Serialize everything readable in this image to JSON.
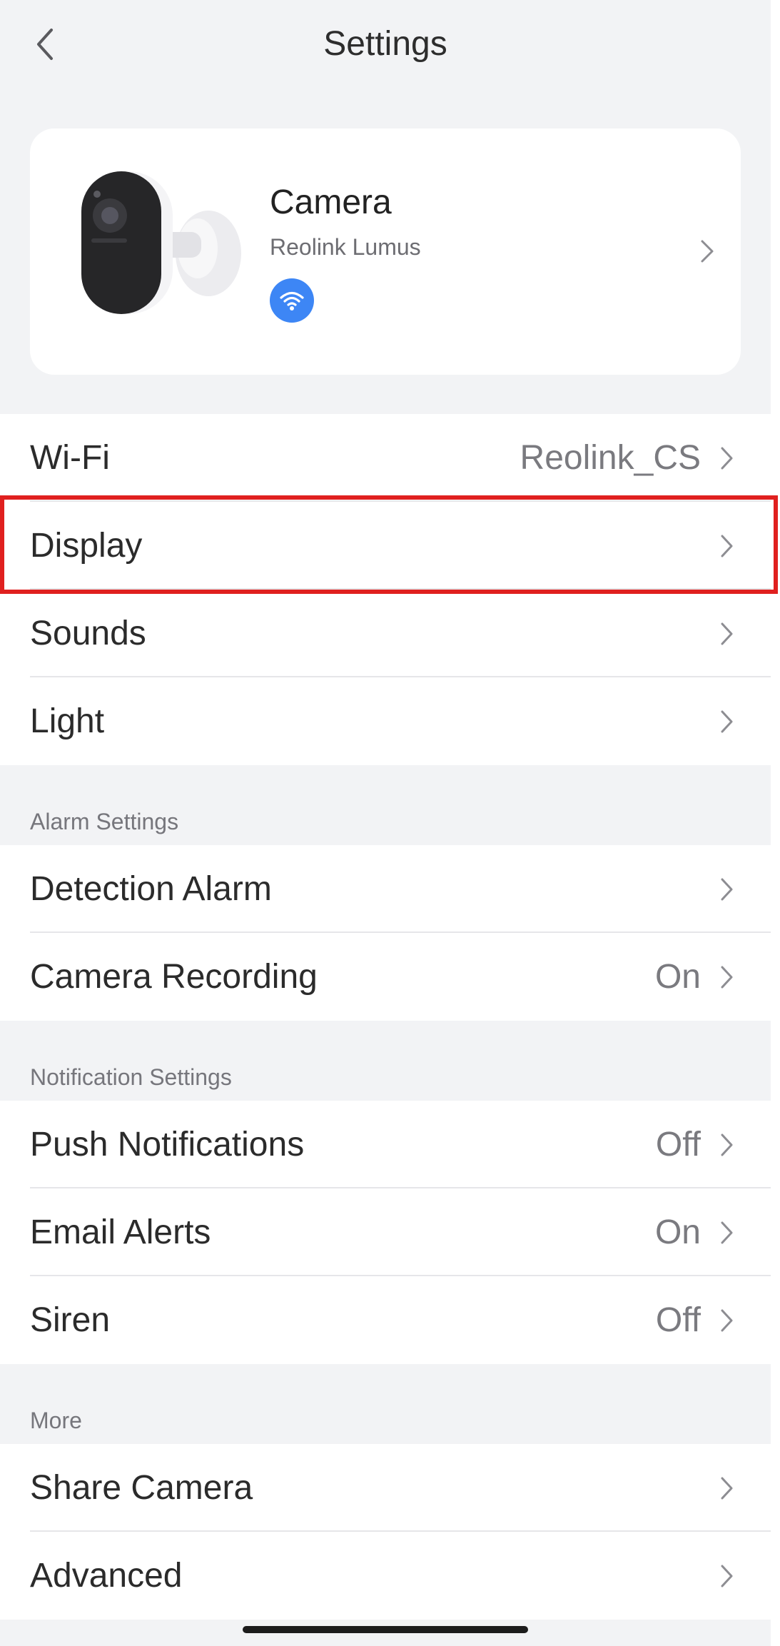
{
  "header": {
    "title": "Settings",
    "back_icon": "chevron-left-icon"
  },
  "camera": {
    "name": "Camera",
    "model": "Reolink Lumus",
    "status_icon": "wifi-icon",
    "status_color": "#3d86f5"
  },
  "groups": {
    "device": [
      {
        "label": "Wi-Fi",
        "value": "Reolink_CS"
      },
      {
        "label": "Display",
        "value": ""
      },
      {
        "label": "Sounds",
        "value": ""
      },
      {
        "label": "Light",
        "value": ""
      }
    ],
    "alarm": [
      {
        "label": "Detection Alarm",
        "value": ""
      },
      {
        "label": "Camera Recording",
        "value": "On"
      }
    ],
    "notification": [
      {
        "label": "Push Notifications",
        "value": "Off"
      },
      {
        "label": "Email Alerts",
        "value": "On"
      },
      {
        "label": "Siren",
        "value": "Off"
      }
    ],
    "more": [
      {
        "label": "Share Camera",
        "value": ""
      },
      {
        "label": "Advanced",
        "value": ""
      }
    ]
  },
  "sections": {
    "alarm_title": "Alarm Settings",
    "notification_title": "Notification Settings",
    "more_title": "More"
  },
  "highlight": {
    "target": "Display",
    "color": "#e0201f"
  }
}
